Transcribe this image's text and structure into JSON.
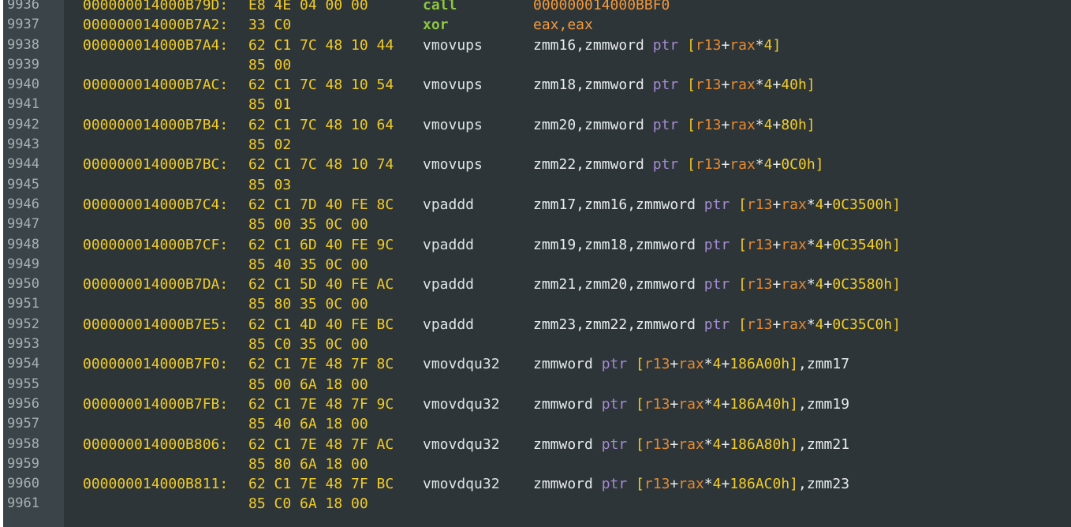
{
  "lines": [
    {
      "ln": "9936",
      "addr": "000000014000B79D:",
      "hex": "E8 4E 04 00 00",
      "mn": "call",
      "ops": "000000014000BBF0"
    },
    {
      "ln": "9937",
      "addr": "000000014000B7A2:",
      "hex": "33 C0",
      "mn": "xor",
      "ops": "eax,eax"
    },
    {
      "ln": "9938",
      "addr": "000000014000B7A4:",
      "hex": "62 C1 7C 48 10 44",
      "mn": "vmovups",
      "ops": {
        "pre": "zmm16,zmmword ",
        "ptr": "ptr",
        "base": "r13",
        "idx": "rax",
        "scale": "*4",
        "disp": "",
        "post": ""
      }
    },
    {
      "ln": "9939",
      "addr": "",
      "hex": "85 00",
      "mn": "",
      "ops": ""
    },
    {
      "ln": "9940",
      "addr": "000000014000B7AC:",
      "hex": "62 C1 7C 48 10 54",
      "mn": "vmovups",
      "ops": {
        "pre": "zmm18,zmmword ",
        "ptr": "ptr",
        "base": "r13",
        "idx": "rax",
        "scale": "*4",
        "disp": "+40h",
        "post": ""
      }
    },
    {
      "ln": "9941",
      "addr": "",
      "hex": "85 01",
      "mn": "",
      "ops": ""
    },
    {
      "ln": "9942",
      "addr": "000000014000B7B4:",
      "hex": "62 C1 7C 48 10 64",
      "mn": "vmovups",
      "ops": {
        "pre": "zmm20,zmmword ",
        "ptr": "ptr",
        "base": "r13",
        "idx": "rax",
        "scale": "*4",
        "disp": "+80h",
        "post": ""
      }
    },
    {
      "ln": "9943",
      "addr": "",
      "hex": "85 02",
      "mn": "",
      "ops": ""
    },
    {
      "ln": "9944",
      "addr": "000000014000B7BC:",
      "hex": "62 C1 7C 48 10 74",
      "mn": "vmovups",
      "ops": {
        "pre": "zmm22,zmmword ",
        "ptr": "ptr",
        "base": "r13",
        "idx": "rax",
        "scale": "*4",
        "disp": "+0C0h",
        "post": ""
      }
    },
    {
      "ln": "9945",
      "addr": "",
      "hex": "85 03",
      "mn": "",
      "ops": ""
    },
    {
      "ln": "9946",
      "addr": "000000014000B7C4:",
      "hex": "62 C1 7D 40 FE 8C",
      "mn": "vpaddd",
      "ops": {
        "pre": "zmm17,zmm16,zmmword ",
        "ptr": "ptr",
        "base": "r13",
        "idx": "rax",
        "scale": "*4",
        "disp": "+0C3500h",
        "post": ""
      }
    },
    {
      "ln": "9947",
      "addr": "",
      "hex": "85 00 35 0C 00",
      "mn": "",
      "ops": ""
    },
    {
      "ln": "9948",
      "addr": "000000014000B7CF:",
      "hex": "62 C1 6D 40 FE 9C",
      "mn": "vpaddd",
      "ops": {
        "pre": "zmm19,zmm18,zmmword ",
        "ptr": "ptr",
        "base": "r13",
        "idx": "rax",
        "scale": "*4",
        "disp": "+0C3540h",
        "post": ""
      }
    },
    {
      "ln": "9949",
      "addr": "",
      "hex": "85 40 35 0C 00",
      "mn": "",
      "ops": ""
    },
    {
      "ln": "9950",
      "addr": "000000014000B7DA:",
      "hex": "62 C1 5D 40 FE AC",
      "mn": "vpaddd",
      "ops": {
        "pre": "zmm21,zmm20,zmmword ",
        "ptr": "ptr",
        "base": "r13",
        "idx": "rax",
        "scale": "*4",
        "disp": "+0C3580h",
        "post": ""
      }
    },
    {
      "ln": "9951",
      "addr": "",
      "hex": "85 80 35 0C 00",
      "mn": "",
      "ops": ""
    },
    {
      "ln": "9952",
      "addr": "000000014000B7E5:",
      "hex": "62 C1 4D 40 FE BC",
      "mn": "vpaddd",
      "ops": {
        "pre": "zmm23,zmm22,zmmword ",
        "ptr": "ptr",
        "base": "r13",
        "idx": "rax",
        "scale": "*4",
        "disp": "+0C35C0h",
        "post": ""
      }
    },
    {
      "ln": "9953",
      "addr": "",
      "hex": "85 C0 35 0C 00",
      "mn": "",
      "ops": ""
    },
    {
      "ln": "9954",
      "addr": "000000014000B7F0:",
      "hex": "62 C1 7E 48 7F 8C",
      "mn": "vmovdqu32",
      "ops": {
        "pre": "zmmword ",
        "ptr": "ptr",
        "base": "r13",
        "idx": "rax",
        "scale": "*4",
        "disp": "+186A00h",
        "post": ",zmm17"
      }
    },
    {
      "ln": "9955",
      "addr": "",
      "hex": "85 00 6A 18 00",
      "mn": "",
      "ops": ""
    },
    {
      "ln": "9956",
      "addr": "000000014000B7FB:",
      "hex": "62 C1 7E 48 7F 9C",
      "mn": "vmovdqu32",
      "ops": {
        "pre": "zmmword ",
        "ptr": "ptr",
        "base": "r13",
        "idx": "rax",
        "scale": "*4",
        "disp": "+186A40h",
        "post": ",zmm19"
      }
    },
    {
      "ln": "9957",
      "addr": "",
      "hex": "85 40 6A 18 00",
      "mn": "",
      "ops": ""
    },
    {
      "ln": "9958",
      "addr": "000000014000B806:",
      "hex": "62 C1 7E 48 7F AC",
      "mn": "vmovdqu32",
      "ops": {
        "pre": "zmmword ",
        "ptr": "ptr",
        "base": "r13",
        "idx": "rax",
        "scale": "*4",
        "disp": "+186A80h",
        "post": ",zmm21"
      }
    },
    {
      "ln": "9959",
      "addr": "",
      "hex": "85 80 6A 18 00",
      "mn": "",
      "ops": ""
    },
    {
      "ln": "9960",
      "addr": "000000014000B811:",
      "hex": "62 C1 7E 48 7F BC",
      "mn": "vmovdqu32",
      "ops": {
        "pre": "zmmword ",
        "ptr": "ptr",
        "base": "r13",
        "idx": "rax",
        "scale": "*4",
        "disp": "+186AC0h",
        "post": ",zmm23"
      }
    },
    {
      "ln": "9961",
      "addr": "",
      "hex": "85 C0 6A 18 00",
      "mn": "",
      "ops": ""
    }
  ]
}
